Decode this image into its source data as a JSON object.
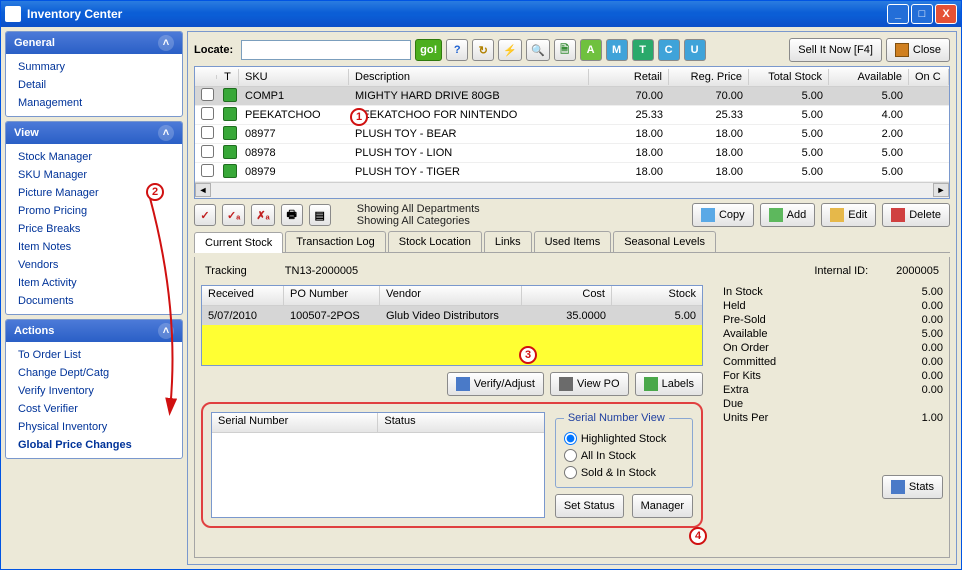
{
  "window": {
    "title": "Inventory Center"
  },
  "toolbar": {
    "locate_label": "Locate:",
    "go": "go!",
    "sell": "Sell It Now [F4]",
    "close": "Close"
  },
  "grid": {
    "headers": {
      "t": "T",
      "sku": "SKU",
      "desc": "Description",
      "retail": "Retail",
      "regprice": "Reg. Price",
      "total": "Total Stock",
      "avail": "Available",
      "onc": "On C"
    },
    "rows": [
      {
        "sku": "COMP1",
        "desc": "MIGHTY HARD DRIVE 80GB",
        "retail": "70.00",
        "regprice": "70.00",
        "total": "5.00",
        "avail": "5.00",
        "sel": true
      },
      {
        "sku": "PEEKATCHOO",
        "desc": "PEEKATCHOO FOR NINTENDO",
        "retail": "25.33",
        "regprice": "25.33",
        "total": "5.00",
        "avail": "4.00"
      },
      {
        "sku": "08977",
        "desc": "PLUSH TOY - BEAR",
        "retail": "18.00",
        "regprice": "18.00",
        "total": "5.00",
        "avail": "2.00"
      },
      {
        "sku": "08978",
        "desc": "PLUSH TOY - LION",
        "retail": "18.00",
        "regprice": "18.00",
        "total": "5.00",
        "avail": "5.00"
      },
      {
        "sku": "08979",
        "desc": "PLUSH TOY - TIGER",
        "retail": "18.00",
        "regprice": "18.00",
        "total": "5.00",
        "avail": "5.00"
      }
    ]
  },
  "midbar": {
    "showing1": "Showing All Departments",
    "showing2": "Showing All Categories",
    "copy": "Copy",
    "add": "Add",
    "edit": "Edit",
    "delete": "Delete"
  },
  "tabs": {
    "current": "Current Stock",
    "trans": "Transaction Log",
    "loc": "Stock Location",
    "links": "Links",
    "used": "Used Items",
    "seasonal": "Seasonal Levels"
  },
  "tracking": {
    "label": "Tracking",
    "value": "TN13-2000005",
    "internal_label": "Internal ID:",
    "internal_value": "2000005"
  },
  "subgrid": {
    "headers": {
      "recv": "Received",
      "po": "PO Number",
      "vendor": "Vendor",
      "cost": "Cost",
      "stock": "Stock"
    },
    "row": {
      "recv": "5/07/2010",
      "po": "100507-2POS",
      "vendor": "Glub Video Distributors",
      "cost": "35.0000",
      "stock": "5.00"
    }
  },
  "buttons": {
    "verify": "Verify/Adjust",
    "viewpo": "View PO",
    "labels": "Labels",
    "setstatus": "Set Status",
    "manager": "Manager",
    "stats": "Stats"
  },
  "serial": {
    "legend": "Serial Number View",
    "col_serial": "Serial Number",
    "col_status": "Status",
    "opt1": "Highlighted Stock",
    "opt2": "All In Stock",
    "opt3": "Sold & In Stock"
  },
  "stats": {
    "items": [
      {
        "label": "In Stock",
        "value": "5.00"
      },
      {
        "label": "Held",
        "value": "0.00"
      },
      {
        "label": "Pre-Sold",
        "value": "0.00"
      },
      {
        "label": "Available",
        "value": "5.00"
      },
      {
        "label": "On Order",
        "value": "0.00"
      },
      {
        "label": "Committed",
        "value": "0.00"
      },
      {
        "label": "For Kits",
        "value": "0.00"
      },
      {
        "label": "Extra",
        "value": "0.00"
      },
      {
        "label": "Due",
        "value": ""
      },
      {
        "label": "Units Per",
        "value": "1.00"
      }
    ]
  },
  "sidebar": {
    "general": {
      "title": "General",
      "items": [
        "Summary",
        "Detail",
        "Management"
      ]
    },
    "view": {
      "title": "View",
      "items": [
        "Stock Manager",
        "SKU Manager",
        "Picture Manager",
        "Promo Pricing",
        "Price Breaks",
        "Item Notes",
        "Vendors",
        "Item Activity",
        "Documents"
      ]
    },
    "actions": {
      "title": "Actions",
      "items": [
        "To Order List",
        "Change Dept/Catg",
        "Verify Inventory",
        "Cost Verifier",
        "Physical Inventory",
        "Global Price Changes"
      ]
    }
  },
  "markers": {
    "m1": "1",
    "m2": "2",
    "m3": "3",
    "m4": "4"
  }
}
